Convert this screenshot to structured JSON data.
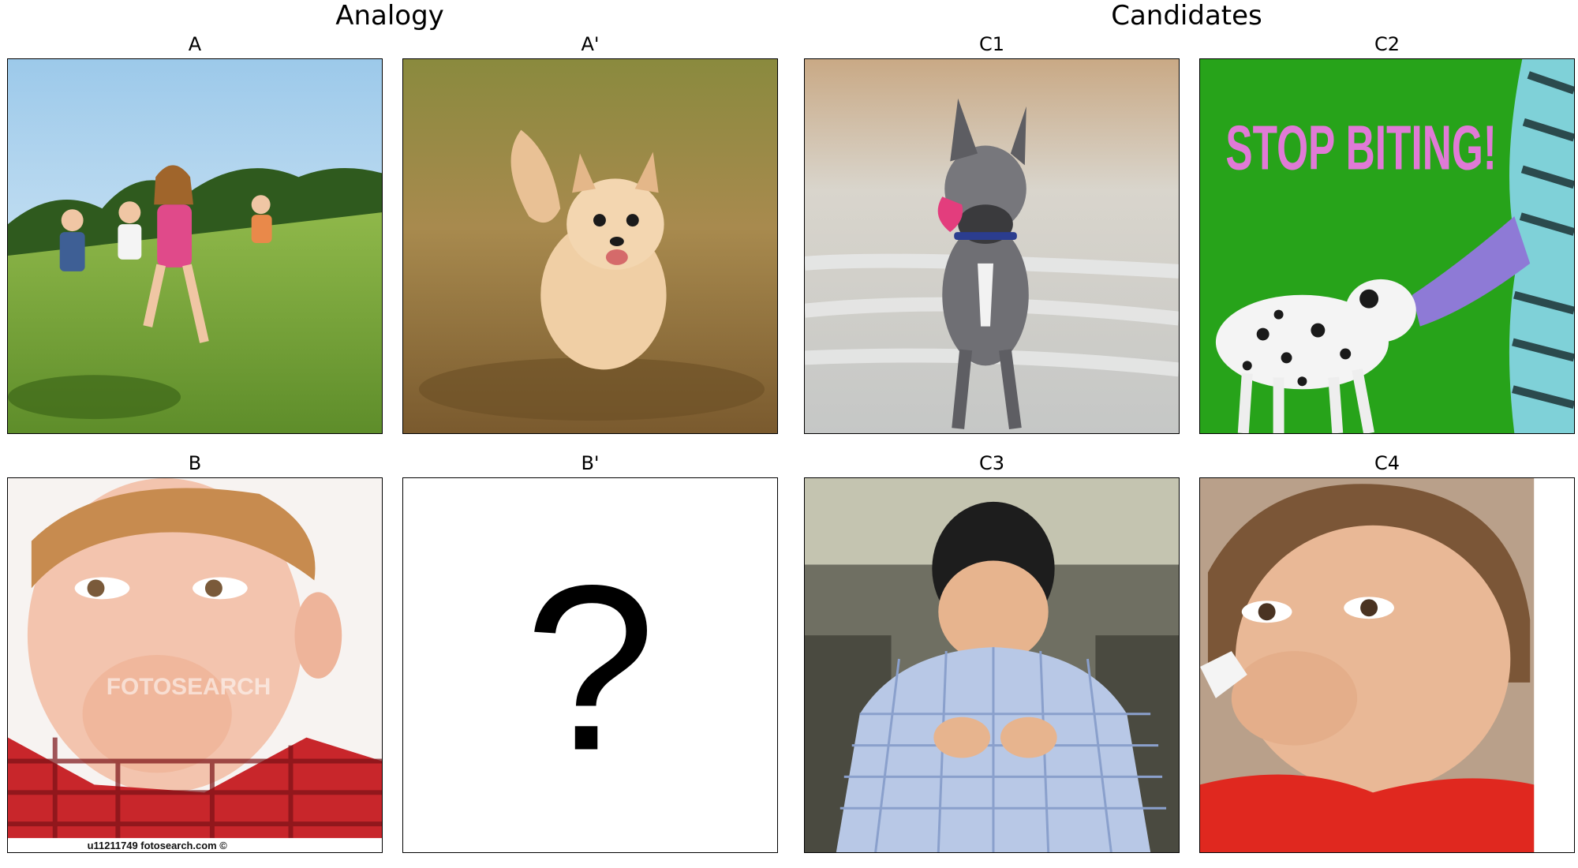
{
  "sections": {
    "analogy": "Analogy",
    "candidates": "Candidates"
  },
  "panels": {
    "a": {
      "title": "A"
    },
    "a_prime": {
      "title": "A'"
    },
    "b": {
      "title": "B",
      "watermark": "FOTOSEARCH",
      "caption": "u11211749 fotosearch.com ©"
    },
    "b_prime": {
      "title": "B'",
      "glyph": "?"
    },
    "c1": {
      "title": "C1"
    },
    "c2": {
      "title": "C2",
      "sign_text": "STOP BITING!"
    },
    "c3": {
      "title": "C3"
    },
    "c4": {
      "title": "C4"
    }
  }
}
